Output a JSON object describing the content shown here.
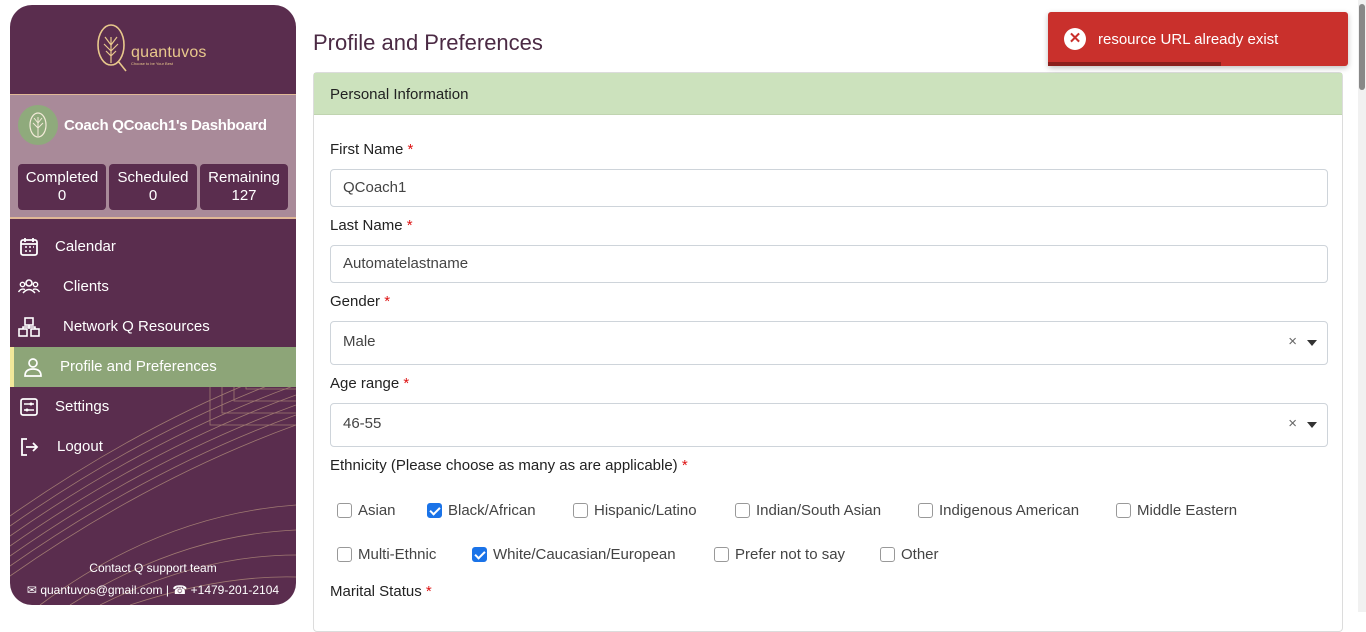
{
  "app": {
    "brand": "quantuvos",
    "tagline": "Choose to be Your Best"
  },
  "dashboard": {
    "title": "Coach QCoach1's Dashboard",
    "stats": [
      {
        "label": "Completed",
        "value": "0"
      },
      {
        "label": "Scheduled",
        "value": "0"
      },
      {
        "label": "Remaining",
        "value": "127"
      }
    ]
  },
  "sidebar": {
    "items": [
      {
        "label": "Calendar",
        "icon": "calendar-icon"
      },
      {
        "label": "Clients",
        "icon": "users-icon"
      },
      {
        "label": "Network Q Resources",
        "icon": "network-icon"
      },
      {
        "label": "Profile and Preferences",
        "icon": "user-icon"
      },
      {
        "label": "Settings",
        "icon": "settings-icon"
      },
      {
        "label": "Logout",
        "icon": "logout-icon"
      }
    ],
    "support_title": "Contact Q support team",
    "support_email": "quantuvos@gmail.com",
    "support_phone": "+1479-201-2104"
  },
  "page": {
    "title": "Profile and Preferences"
  },
  "section": {
    "title": "Personal Information"
  },
  "form": {
    "first_name": {
      "label": "First Name",
      "value": "QCoach1"
    },
    "last_name": {
      "label": "Last Name",
      "value": "Automatelastname"
    },
    "gender": {
      "label": "Gender",
      "value": "Male"
    },
    "age_range": {
      "label": "Age range",
      "value": "46-55"
    },
    "ethnicity": {
      "label": "Ethnicity (Please choose as many as are applicable)",
      "options": [
        {
          "label": "Asian",
          "checked": false
        },
        {
          "label": "Black/African",
          "checked": true
        },
        {
          "label": "Hispanic/Latino",
          "checked": false
        },
        {
          "label": "Indian/South Asian",
          "checked": false
        },
        {
          "label": "Indigenous American",
          "checked": false
        },
        {
          "label": "Middle Eastern",
          "checked": false
        },
        {
          "label": "Multi-Ethnic",
          "checked": false
        },
        {
          "label": "White/Caucasian/European",
          "checked": true
        },
        {
          "label": "Prefer not to say",
          "checked": false
        },
        {
          "label": "Other",
          "checked": false
        }
      ]
    },
    "marital_status": {
      "label": "Marital Status"
    },
    "required_mark": "*"
  },
  "toast": {
    "message": "resource URL already exist",
    "icon": "error-icon"
  },
  "colors": {
    "sidebar_bg": "#5a2d4e",
    "accent_green": "#8da578",
    "header_green": "#cce2bd",
    "toast_red": "#c9302c"
  }
}
